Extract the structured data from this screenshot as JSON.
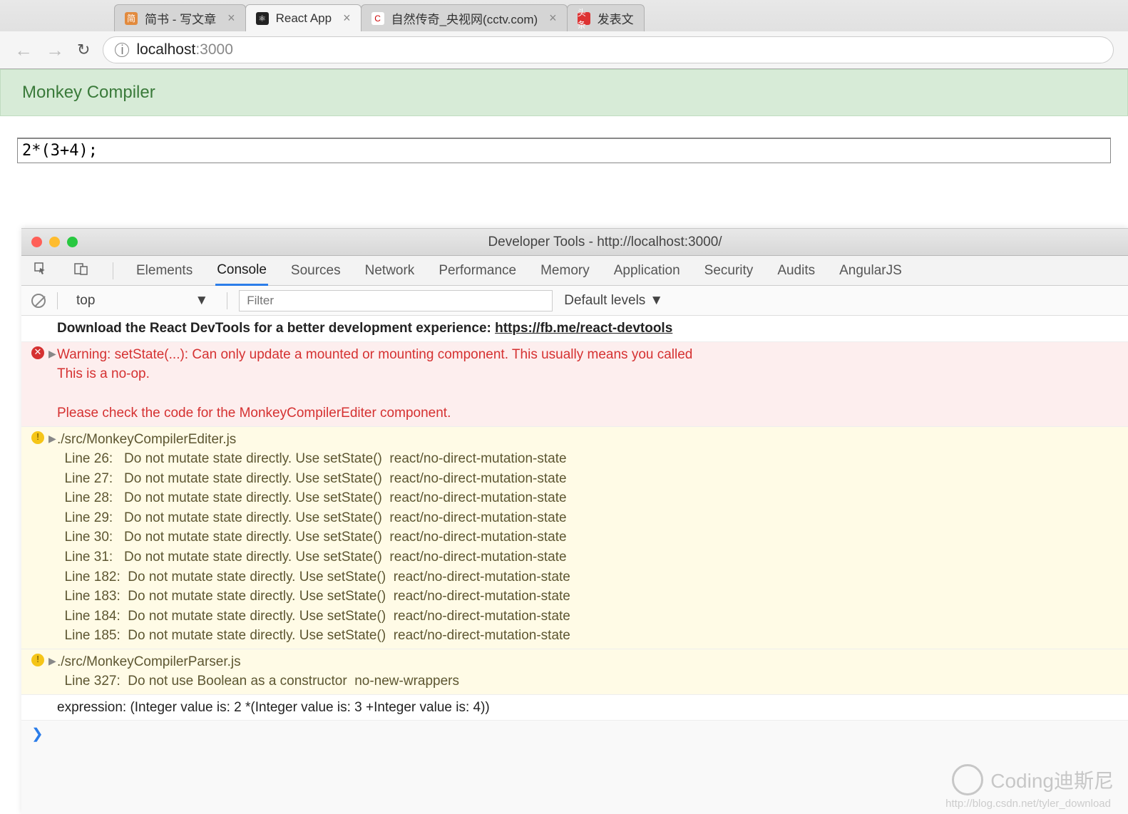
{
  "browser": {
    "tabs": [
      {
        "favicon_bg": "#e28a3d",
        "favicon_text": "简",
        "title": "简书 - 写文章",
        "active": false
      },
      {
        "favicon_bg": "#222",
        "favicon_text": "⚛",
        "title": "React App",
        "active": true
      },
      {
        "favicon_bg": "#fff",
        "favicon_text": "C",
        "favicon_color": "#c00",
        "title": "自然传奇_央视网(cctv.com)",
        "active": false
      },
      {
        "favicon_bg": "#d33",
        "favicon_text": "头条",
        "title": "发表文",
        "active": false,
        "noclose": true
      }
    ],
    "address_host": "localhost",
    "address_port": ":3000"
  },
  "page": {
    "header": "Monkey Compiler",
    "code": "2*(3+4);"
  },
  "devtools": {
    "window_title": "Developer Tools - http://localhost:3000/",
    "tabs": [
      "Elements",
      "Console",
      "Sources",
      "Network",
      "Performance",
      "Memory",
      "Application",
      "Security",
      "Audits",
      "AngularJS"
    ],
    "active_tab": "Console",
    "context": "top",
    "filter_placeholder": "Filter",
    "levels": "Default levels",
    "messages": [
      {
        "type": "info",
        "text": "Download the React DevTools for a better development experience: ",
        "link": "https://fb.me/react-devtools"
      },
      {
        "type": "error",
        "text": "Warning: setState(...): Can only update a mounted or mounting component. This usually means you called\nThis is a no-op.\n\nPlease check the code for the MonkeyCompilerEditer component."
      },
      {
        "type": "warn",
        "text": "./src/MonkeyCompilerEditer.js\n  Line 26:   Do not mutate state directly. Use setState()  react/no-direct-mutation-state\n  Line 27:   Do not mutate state directly. Use setState()  react/no-direct-mutation-state\n  Line 28:   Do not mutate state directly. Use setState()  react/no-direct-mutation-state\n  Line 29:   Do not mutate state directly. Use setState()  react/no-direct-mutation-state\n  Line 30:   Do not mutate state directly. Use setState()  react/no-direct-mutation-state\n  Line 31:   Do not mutate state directly. Use setState()  react/no-direct-mutation-state\n  Line 182:  Do not mutate state directly. Use setState()  react/no-direct-mutation-state\n  Line 183:  Do not mutate state directly. Use setState()  react/no-direct-mutation-state\n  Line 184:  Do not mutate state directly. Use setState()  react/no-direct-mutation-state\n  Line 185:  Do not mutate state directly. Use setState()  react/no-direct-mutation-state"
      },
      {
        "type": "warn",
        "text": "./src/MonkeyCompilerParser.js\n  Line 327:  Do not use Boolean as a constructor  no-new-wrappers"
      },
      {
        "type": "log",
        "text": "expression: (Integer value is: 2 *(Integer value is: 3 +Integer value is: 4))"
      }
    ]
  },
  "watermark": {
    "text": "Coding迪斯尼",
    "sub": "http://blog.csdn.net/tyler_download"
  }
}
